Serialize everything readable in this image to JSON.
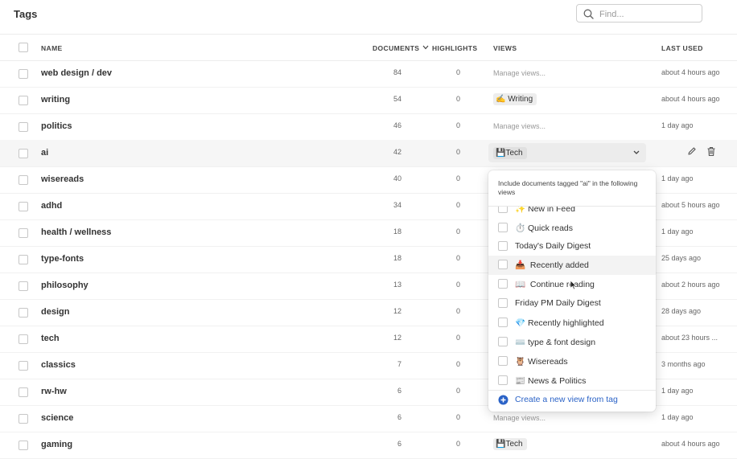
{
  "page": {
    "title": "Tags"
  },
  "search": {
    "placeholder": "Find..."
  },
  "columns": {
    "name": "NAME",
    "documents": "DOCUMENTS",
    "highlights": "HIGHLIGHTS",
    "views": "VIEWS",
    "last_used": "LAST USED"
  },
  "rows": [
    {
      "name": "web design / dev",
      "documents": "84",
      "highlights": "0",
      "views": "Manage views...",
      "last_used": "about 4 hours ago"
    },
    {
      "name": "writing",
      "documents": "54",
      "highlights": "0",
      "view_emoji": "✍️",
      "view_tag": "Writing",
      "last_used": "about 4 hours ago"
    },
    {
      "name": "politics",
      "documents": "46",
      "highlights": "0",
      "views": "Manage views...",
      "last_used": "1 day ago"
    },
    {
      "name": "ai",
      "documents": "42",
      "highlights": "0",
      "view_emoji": "💾",
      "view_tag": "Tech",
      "last_used": ""
    },
    {
      "name": "wisereads",
      "documents": "40",
      "highlights": "0",
      "last_used": "1 day ago"
    },
    {
      "name": "adhd",
      "documents": "34",
      "highlights": "0",
      "last_used": "about 5 hours ago"
    },
    {
      "name": "health / wellness",
      "documents": "18",
      "highlights": "0",
      "last_used": "1 day ago"
    },
    {
      "name": "type-fonts",
      "documents": "18",
      "highlights": "0",
      "last_used": "25 days ago"
    },
    {
      "name": "philosophy",
      "documents": "13",
      "highlights": "0",
      "last_used": "about 2 hours ago"
    },
    {
      "name": "design",
      "documents": "12",
      "highlights": "0",
      "last_used": "28 days ago"
    },
    {
      "name": "tech",
      "documents": "12",
      "highlights": "0",
      "last_used": "about 23 hours ..."
    },
    {
      "name": "classics",
      "documents": "7",
      "highlights": "0",
      "last_used": "3 months ago"
    },
    {
      "name": "rw-hw",
      "documents": "6",
      "highlights": "0",
      "last_used": "1 day ago"
    },
    {
      "name": "science",
      "documents": "6",
      "highlights": "0",
      "views": "Manage views...",
      "last_used": "1 day ago"
    },
    {
      "name": "gaming",
      "documents": "6",
      "highlights": "0",
      "view_emoji": "💾",
      "view_tag": "Tech",
      "last_used": "about 4 hours ago"
    }
  ],
  "popup": {
    "title": "Include documents tagged \"ai\" in the following views",
    "items": [
      {
        "emoji": "✨",
        "label": "New in Feed"
      },
      {
        "emoji": "⏱️",
        "label": "Quick reads"
      },
      {
        "emoji": "",
        "label": "Today's Daily Digest"
      },
      {
        "emoji": "📥",
        "label": "Recently added"
      },
      {
        "emoji": "📖",
        "label": "Continue reading"
      },
      {
        "emoji": "",
        "label": "Friday PM Daily Digest"
      },
      {
        "emoji": "💎",
        "label": "Recently highlighted"
      },
      {
        "emoji": "⌨️",
        "label": "type & font design"
      },
      {
        "emoji": "🦉",
        "label": "Wisereads"
      },
      {
        "emoji": "📰",
        "label": "News & Politics"
      }
    ],
    "create_label": "Create a new view from tag"
  },
  "colors": {
    "accent": "#2b63c7",
    "row_highlight": "#f6f6f6"
  }
}
